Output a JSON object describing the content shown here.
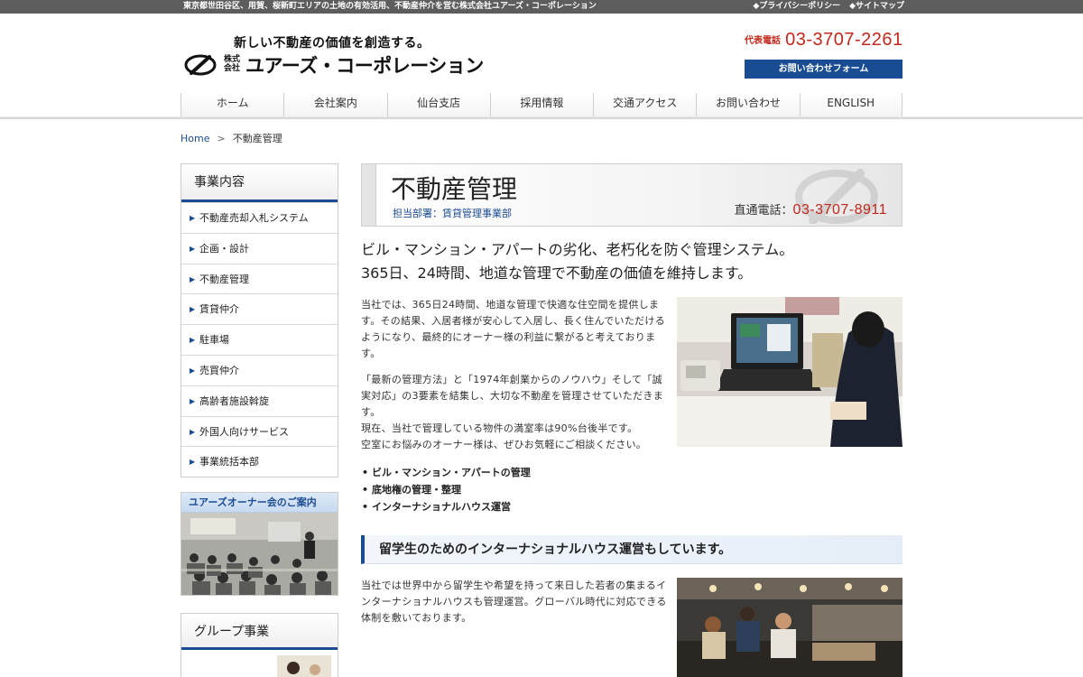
{
  "topbar": {
    "tagline": "東京都世田谷区、用賀、桜新町エリアの土地の有効活用、不動産仲介を営む株式会社ユアーズ・コーポレーション",
    "links": [
      "◆プライバシーポリシー",
      "◆サイトマップ"
    ]
  },
  "logo": {
    "tagline": "新しい不動産の価値を創造する。",
    "company_small": "株式会社",
    "company_name": "ユアーズ・コーポレーション"
  },
  "contact": {
    "rep_label": "代表電話",
    "rep_phone": "03-3707-2261",
    "form_button": "お問い合わせフォーム"
  },
  "nav": [
    "ホーム",
    "会社案内",
    "仙台支店",
    "採用情報",
    "交通アクセス",
    "お問い合わせ",
    "ENGLISH"
  ],
  "breadcrumb": {
    "home": "Home",
    "sep": ">",
    "current": "不動産管理"
  },
  "sidebar": {
    "title": "事業内容",
    "items": [
      "不動産売却入札システム",
      "企画・設計",
      "不動産管理",
      "賃貸仲介",
      "駐車場",
      "売買仲介",
      "高齢者施設斡旋",
      "外国人向けサービス",
      "事業統括本部"
    ],
    "owner_banner": "ユアーズオーナー会のご案内",
    "group_title": "グループ事業"
  },
  "page": {
    "title": "不動産管理",
    "dept": "担当部署：賃貸管理事業部",
    "direct_label": "直通電話：",
    "direct_phone": "03-3707-8911",
    "lead": [
      "ビル・マンション・アパートの劣化、老朽化を防ぐ管理システム。",
      "365日、24時間、地道な管理で不動産の価値を維持します。"
    ],
    "p1": "当社では、365日24時間、地道な管理で快適な住空間を提供します。その結果、入居者様が安心して入居し、長く住んでいただけるようになり、最終的にオーナー様の利益に繋がると考えております。",
    "p2_lines": [
      "「最新の管理方法」と「1974年創業からのノウハウ」そして「誠実対応」の3要素を結集し、大切な不動産を管理させていただきます。",
      "現在、当社で管理している物件の満室率は90%台後半です。",
      "空室にお悩みのオーナー様は、ぜひお気軽にご相談ください。"
    ],
    "bullets": [
      "ビル・マンション・アパートの管理",
      "底地権の管理・整理",
      "インターナショナルハウス運営"
    ],
    "sub_heading": "留学生のためのインターナショナルハウス運営もしています。",
    "p3": "当社では世界中から留学生や希望を持って来日した若者の集まるインターナショナルハウスも管理運営。グローバル時代に対応できる体制を敷いております。"
  },
  "colors": {
    "accent": "#1a4c93",
    "phone": "#c2281b"
  }
}
